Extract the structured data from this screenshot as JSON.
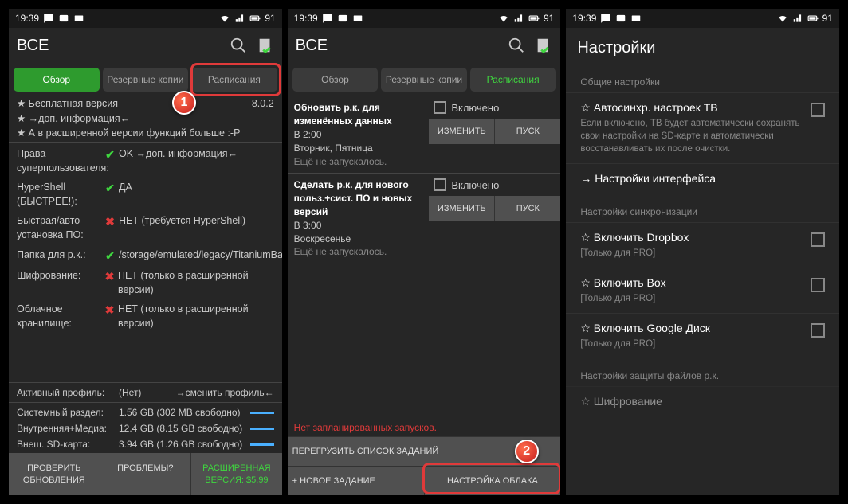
{
  "status": {
    "time": "19:39",
    "battery": "91"
  },
  "appTitle": "ВСЕ",
  "tabs": {
    "overview": "Обзор",
    "backups": "Резервные копии",
    "schedules": "Расписания"
  },
  "s1": {
    "free": "★ Бесплатная версия",
    "version": "8.0.2",
    "info": "★ →доп. информация←",
    "ext": "★ А в расширенной версии функций больше :-P",
    "root_l": "Права суперпользователя:",
    "root_v": "OK →доп. информация←",
    "hyper_l": "HyperShell (БЫСТРЕЕ!):",
    "hyper_v": "ДА",
    "auto_l": "Быстрая/авто установка ПО:",
    "auto_v": "НЕТ (требуется HyperShell)",
    "folder_l": "Папка для р.к.:",
    "folder_v": "/storage/emulated/legacy/TitaniumBackup",
    "enc_l": "Шифрование:",
    "enc_v": "НЕТ (только в расширенной версии)",
    "cloud_l": "Облачное хранилище:",
    "cloud_v": "НЕТ (только в расширенной версии)",
    "profile_l": "Активный профиль:",
    "profile_v": "(Нет)",
    "profile_c": "→сменить профиль←",
    "sys_l": "Системный раздел:",
    "sys_v": "1.56 GB (302 MB свободно)",
    "int_l": "Внутренняя+Медиа:",
    "int_v": "12.4 GB (8.15 GB свободно)",
    "sd_l": "Внеш. SD-карта:",
    "sd_v": "3.94 GB (1.26 GB свободно)",
    "check": "ПРОВЕРИТЬ ОБНОВЛЕНИЯ",
    "prob": "ПРОБЛЕМЫ?",
    "pro": "РАСШИРЕННАЯ ВЕРСИЯ: $5,99"
  },
  "s2": {
    "t1_title": "Обновить р.к. для изменённых данных",
    "t1_time": "В 2:00",
    "t1_days": "Вторник, Пятница",
    "t1_last": "Ещё не запускалось.",
    "t2_title": "Сделать р.к. для нового польз.+сист. ПО и новых версий",
    "t2_time": "В 3:00",
    "t2_days": "Воскресенье",
    "t2_last": "Ещё не запускалось.",
    "enabled": "Включено",
    "edit": "ИЗМЕНИТЬ",
    "run": "ПУСК",
    "noruns": "Нет запланированных запусков.",
    "reload": "ПЕРЕГРУЗИТЬ СПИСОК ЗАДАНИЙ",
    "newtask": "+ НОВОЕ ЗАДАНИЕ",
    "cloud": "НАСТРОЙКА ОБЛАКА"
  },
  "s3": {
    "title": "Настройки",
    "sec1": "Общие настройки",
    "autosync_t": "☆ Автосинхр. настроек TB",
    "autosync_d": "Если включено, TB будет автоматически сохранять свои настройки на SD-карте и автоматически восстанавливать их после очистки.",
    "ui_t": "→ Настройки интерфейса",
    "sec2": "Настройки синхронизации",
    "dropbox_t": "☆ Включить Dropbox",
    "pro": "[Только для PRO]",
    "box_t": "☆ Включить Box",
    "gdrive_t": "☆ Включить Google Диск",
    "sec3": "Настройки защиты файлов р.к.",
    "enc_t": "☆ Шифрование"
  }
}
